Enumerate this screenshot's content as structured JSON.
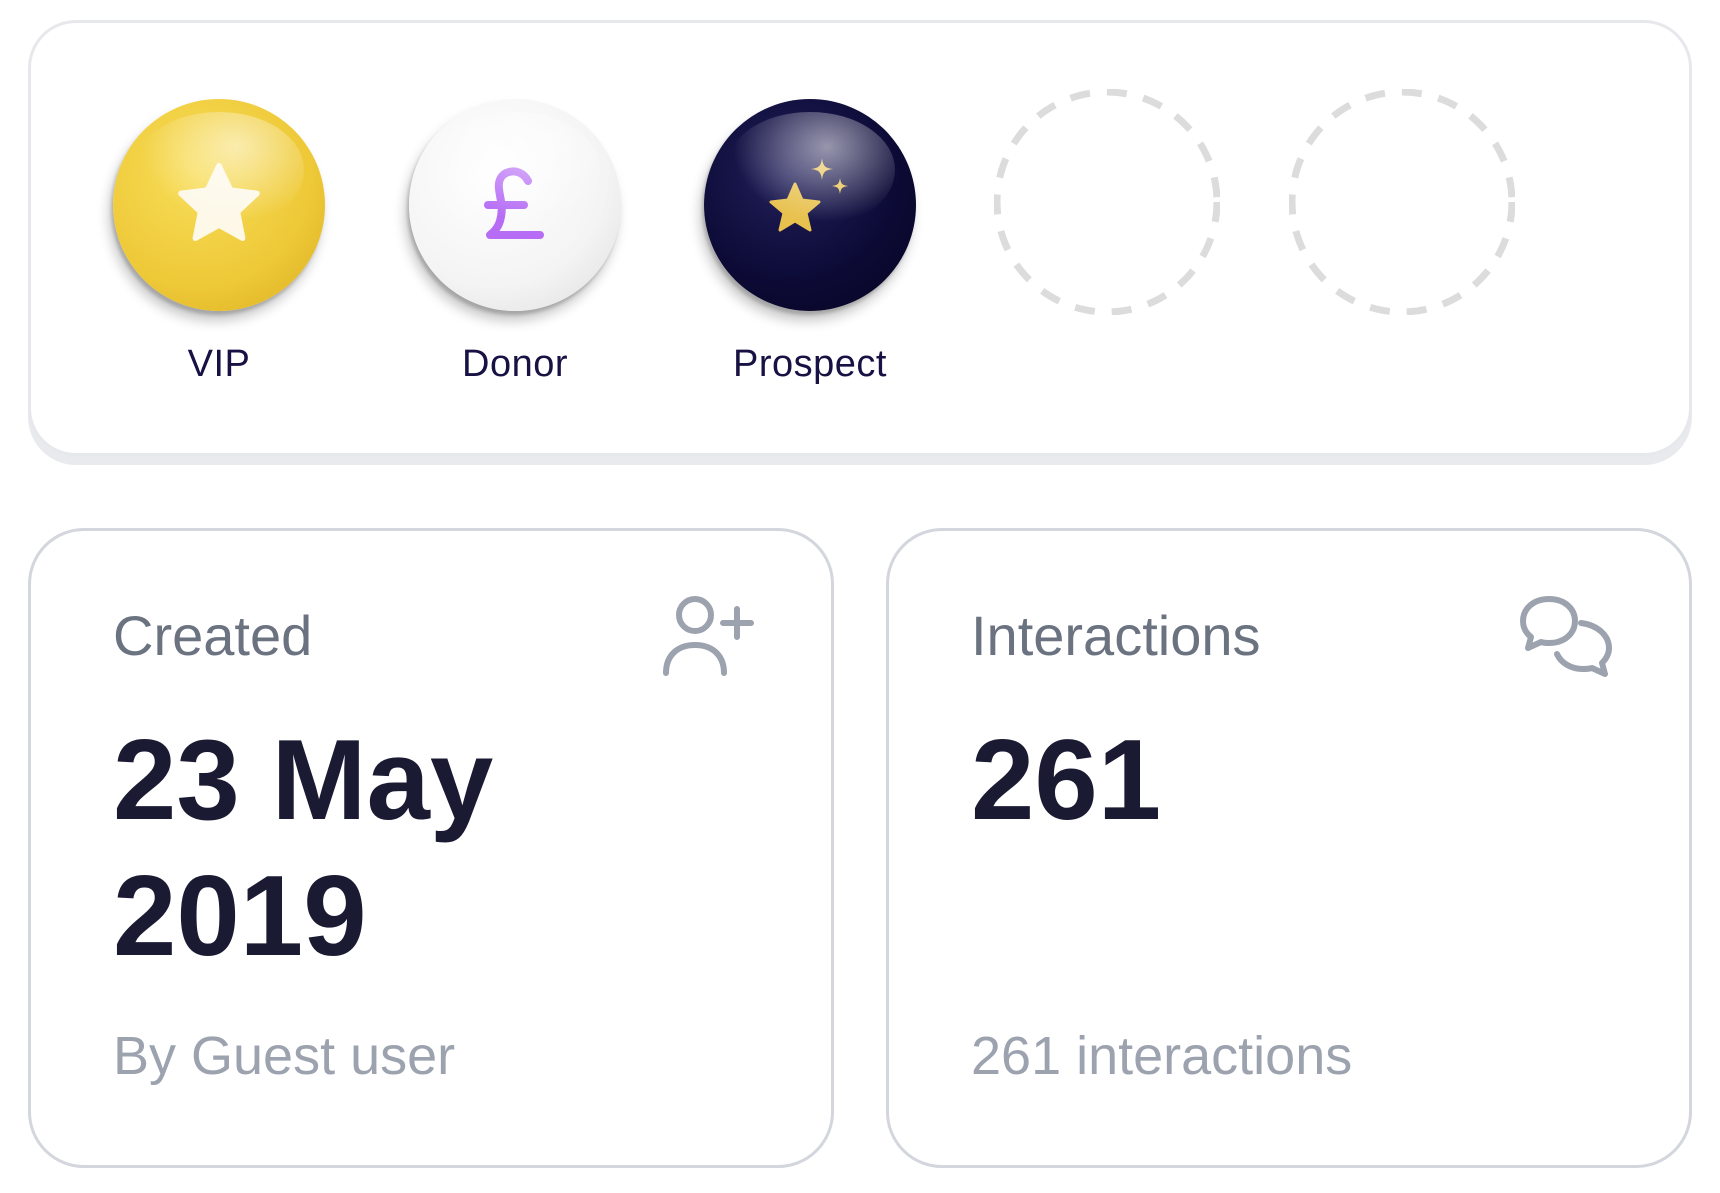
{
  "badges": [
    {
      "label": "VIP",
      "icon": "star-icon",
      "color": "#eec938",
      "icon_color": "#fdf8e8"
    },
    {
      "label": "Donor",
      "icon": "pound-sign-icon",
      "color": "#f4f4f4",
      "icon_color": "#b66cf5"
    },
    {
      "label": "Prospect",
      "icon": "sparkle-star-icon",
      "color": "#0d0b37",
      "icon_color": "#e8c14f"
    }
  ],
  "empty_slots": 2,
  "created": {
    "title": "Created",
    "value_line1": "23 May",
    "value_line2": "2019",
    "subtitle": "By Guest user",
    "icon": "user-plus-icon"
  },
  "interactions": {
    "title": "Interactions",
    "value": "261",
    "subtitle": "261 interactions",
    "icon": "chat-bubbles-icon"
  },
  "colors": {
    "text_dark": "#1b1a33",
    "text_muted": "#6b7280",
    "text_light": "#9ca3af",
    "border": "#d3d6dc",
    "dashed_slot": "#dcdcdc"
  }
}
